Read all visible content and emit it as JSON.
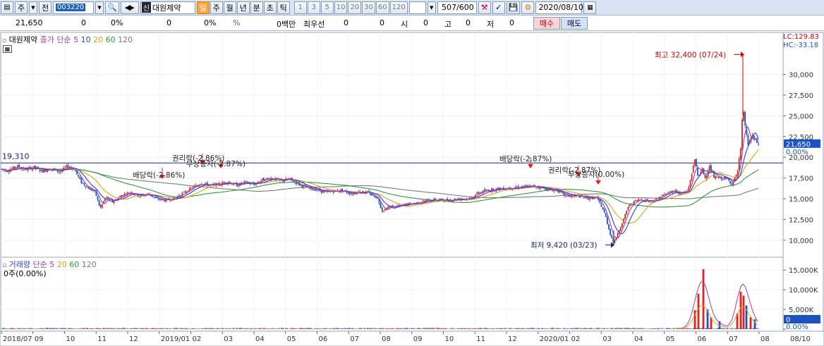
{
  "toolbar": {
    "type_label": "주",
    "prev_label": "전",
    "code_value": "003220",
    "name_prefix": "신",
    "stock_name": "대원제약",
    "periods": [
      "일",
      "주",
      "월",
      "년",
      "분",
      "초",
      "틱"
    ],
    "active_period": "일",
    "intervals": [
      "1",
      "3",
      "5",
      "10",
      "20",
      "30",
      "60",
      "120"
    ],
    "count_value": "507",
    "count_total": "/600",
    "date_value": "2020/08/10"
  },
  "quote": {
    "price": "21,650",
    "change": "0",
    "change_pct": "0%",
    "volume": "0",
    "volume_pct": "0%",
    "amount": "0백만",
    "priority_label": "최우선",
    "priority_values": [
      "0",
      "0"
    ],
    "open_label": "시",
    "open": "0",
    "high_label": "고",
    "high": "0",
    "low_label": "저",
    "low": "0",
    "buy_label": "매수",
    "sell_label": "매도"
  },
  "price_panel": {
    "stock": "대원제약",
    "legend_prefix": "종가 단순",
    "ma_periods": [
      "5",
      "10",
      "20",
      "60",
      "120"
    ],
    "lc_label": "LC:129.83",
    "hc_label": "HC:-33.18",
    "level_label": "19,310",
    "current_price_label": "21,650",
    "current_pct_label": "0.00%",
    "high_label": "최고 32,400 (07/24)",
    "low_label": "최저 9,420 (03/23)",
    "events": [
      {
        "label": "배당락(-2.86%)"
      },
      {
        "label": "권리락(-2.86%)"
      },
      {
        "label": "무상증자(-2.87%)"
      },
      {
        "label": "배당락(-2.87%)"
      },
      {
        "label": "권리락(-2.87%)"
      },
      {
        "label": "무상증자(0.00%)"
      }
    ]
  },
  "volume_panel": {
    "legend_title": "거래량",
    "legend_prefix": "단순",
    "ma_periods": [
      "5",
      "20",
      "60",
      "120"
    ],
    "current_label": "0주(0.00%)",
    "current_value_label": "0",
    "current_pct_label": "0.00%"
  },
  "colors": {
    "candle_up": "#e0241c",
    "candle_down": "#1d52c4",
    "ma5": "#9b3fb0",
    "ma10": "#2b43c8",
    "ma20": "#e0a020",
    "ma60": "#2f9a3a",
    "ma120": "#7a7a7a",
    "level_line": "#1a237e"
  },
  "chart_data": [
    {
      "type": "candlestick",
      "x_ticks": [
        "2018/07",
        "09",
        "10",
        "11",
        "12",
        "2019/01",
        "02",
        "03",
        "04",
        "05",
        "06",
        "07",
        "08",
        "09",
        "10",
        "11",
        "12",
        "2020/01",
        "02",
        "03",
        "04",
        "05",
        "06",
        "07",
        "08",
        "08/10"
      ],
      "y_ticks": [
        10000,
        12500,
        15000,
        17500,
        20000,
        22500,
        25000,
        27500,
        30000
      ],
      "y_tick_labels": [
        "10,000",
        "12,500",
        "15,000",
        "17,500",
        "20,000",
        "22,500",
        "25,000",
        "27,500",
        "30,000"
      ],
      "ylim": [
        8200,
        33700
      ],
      "horizontal_line": 19310,
      "max": {
        "value": 32400,
        "date": "07/24"
      },
      "min": {
        "value": 9420,
        "date": "03/23"
      },
      "close_path": [
        [
          0,
          18600
        ],
        [
          10,
          18400
        ],
        [
          25,
          18900
        ],
        [
          35,
          18500
        ],
        [
          48,
          18800
        ],
        [
          60,
          18300
        ],
        [
          70,
          18700
        ],
        [
          85,
          18200
        ],
        [
          95,
          18900
        ],
        [
          105,
          18600
        ],
        [
          115,
          17000
        ],
        [
          125,
          16300
        ],
        [
          135,
          15800
        ],
        [
          142,
          13800
        ],
        [
          150,
          15200
        ],
        [
          160,
          14600
        ],
        [
          172,
          15400
        ],
        [
          185,
          15800
        ],
        [
          198,
          15300
        ],
        [
          210,
          15600
        ],
        [
          222,
          15000
        ],
        [
          235,
          14800
        ],
        [
          248,
          15100
        ],
        [
          260,
          15700
        ],
        [
          272,
          16300
        ],
        [
          285,
          16900
        ],
        [
          298,
          16600
        ],
        [
          310,
          16700
        ],
        [
          322,
          17100
        ],
        [
          335,
          16600
        ],
        [
          348,
          17000
        ],
        [
          360,
          16700
        ],
        [
          372,
          17300
        ],
        [
          385,
          17500
        ],
        [
          398,
          17100
        ],
        [
          410,
          17400
        ],
        [
          422,
          16800
        ],
        [
          435,
          16300
        ],
        [
          448,
          16100
        ],
        [
          460,
          15800
        ],
        [
          472,
          15900
        ],
        [
          485,
          16000
        ],
        [
          498,
          15600
        ],
        [
          510,
          15900
        ],
        [
          522,
          15700
        ],
        [
          535,
          15100
        ],
        [
          542,
          13500
        ],
        [
          550,
          14000
        ],
        [
          562,
          14100
        ],
        [
          575,
          14300
        ],
        [
          590,
          14500
        ],
        [
          605,
          14800
        ],
        [
          620,
          14900
        ],
        [
          635,
          14800
        ],
        [
          650,
          15000
        ],
        [
          665,
          15000
        ],
        [
          678,
          15700
        ],
        [
          690,
          16000
        ],
        [
          705,
          16200
        ],
        [
          720,
          16300
        ],
        [
          735,
          16400
        ],
        [
          750,
          16500
        ],
        [
          765,
          16400
        ],
        [
          778,
          16100
        ],
        [
          790,
          16000
        ],
        [
          800,
          15400
        ],
        [
          810,
          15300
        ],
        [
          822,
          15300
        ],
        [
          835,
          15000
        ],
        [
          845,
          15200
        ],
        [
          852,
          14200
        ],
        [
          858,
          13000
        ],
        [
          864,
          11000
        ],
        [
          870,
          9600
        ],
        [
          876,
          11000
        ],
        [
          882,
          12000
        ],
        [
          890,
          14000
        ],
        [
          898,
          14600
        ],
        [
          906,
          14900
        ],
        [
          915,
          14800
        ],
        [
          925,
          14700
        ],
        [
          935,
          15200
        ],
        [
          945,
          15600
        ],
        [
          955,
          16000
        ],
        [
          965,
          15600
        ],
        [
          975,
          15900
        ],
        [
          985,
          19800
        ],
        [
          990,
          17500
        ],
        [
          995,
          18600
        ],
        [
          1000,
          17400
        ],
        [
          1005,
          19000
        ],
        [
          1012,
          17600
        ],
        [
          1020,
          17500
        ],
        [
          1030,
          17400
        ],
        [
          1038,
          16800
        ],
        [
          1045,
          18000
        ],
        [
          1050,
          21000
        ],
        [
          1053,
          26000
        ],
        [
          1056,
          24000
        ],
        [
          1060,
          21500
        ],
        [
          1066,
          22600
        ],
        [
          1072,
          21800
        ],
        [
          1076,
          21650
        ]
      ]
    },
    {
      "type": "bar",
      "title": "거래량",
      "y_ticks": [
        0,
        5000,
        10000,
        15000
      ],
      "y_tick_labels": [
        "0",
        "5,000K",
        "10,000K",
        "15,000K"
      ],
      "ylim": [
        0,
        17000
      ],
      "spikes": [
        [
          985,
          4800
        ],
        [
          990,
          9000
        ],
        [
          997,
          15200
        ],
        [
          1003,
          5000
        ],
        [
          1008,
          3000
        ],
        [
          1020,
          2000
        ],
        [
          1045,
          4000
        ],
        [
          1050,
          9500
        ],
        [
          1054,
          8500
        ],
        [
          1058,
          6000
        ],
        [
          1064,
          3000
        ],
        [
          1070,
          2500
        ]
      ]
    }
  ]
}
